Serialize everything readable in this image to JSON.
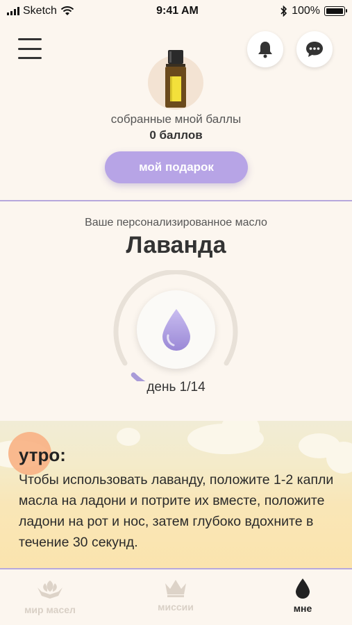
{
  "status_bar": {
    "carrier": "Sketch",
    "time": "9:41 AM",
    "battery": "100%"
  },
  "header": {
    "points_label": "собранные мной баллы",
    "points_value": "0 баллов",
    "gift_button": "мой подарок"
  },
  "oil": {
    "subtitle": "Ваше персонализированное масло",
    "name": "Лаванда",
    "day_label": "день 1/14",
    "progress_fraction": 0.071
  },
  "morning": {
    "title": "утро:",
    "text": "Чтобы использовать лаванду, положите 1-2 капли масла на ладони и потрите их вместе, положите ладони на рот и нос, затем глубоко вдохните в течение 30 секунд."
  },
  "tabs": [
    {
      "label": "мир масел",
      "icon": "hands-leaf-icon",
      "active": false
    },
    {
      "label": "миссии",
      "icon": "crown-icon",
      "active": false
    },
    {
      "label": "мне",
      "icon": "drop-icon",
      "active": true
    }
  ],
  "colors": {
    "accent": "#b7a4e6",
    "background": "#fcf6ef",
    "divider": "#b6a8dc"
  }
}
